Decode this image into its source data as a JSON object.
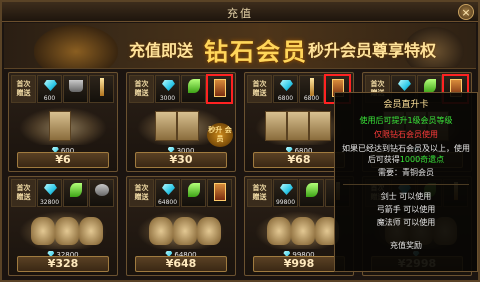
{
  "window": {
    "title": "充值",
    "close_glyph": "×"
  },
  "banner": {
    "part1": "充值即送",
    "part2": "钻石会员",
    "part3": "秒升会员尊享特权"
  },
  "first_gift_label": "首次\n赠送",
  "cards": [
    {
      "items": [
        {
          "icon": "diamond-icon",
          "count": "600"
        },
        {
          "icon": "cup-icon",
          "count": ""
        },
        {
          "icon": "staff-icon",
          "count": ""
        }
      ],
      "diamonds": "600",
      "price": "¥6",
      "highlight": null
    },
    {
      "items": [
        {
          "icon": "diamond-icon",
          "count": "3000"
        },
        {
          "icon": "leaf-icon",
          "count": ""
        },
        {
          "icon": "member-card-icon",
          "count": ""
        }
      ],
      "diamonds": "3000",
      "price": "¥30",
      "badge": "秒升\n会员",
      "highlight": 2
    },
    {
      "items": [
        {
          "icon": "diamond-icon",
          "count": "6800"
        },
        {
          "icon": "staff-icon",
          "count": "6800"
        },
        {
          "icon": "member-card-icon",
          "count": ""
        }
      ],
      "diamonds": "6800",
      "price": "¥68",
      "highlight": 2
    },
    {
      "items": [
        {
          "icon": "diamond-icon",
          "count": ""
        },
        {
          "icon": "leaf-icon",
          "count": ""
        },
        {
          "icon": "member-card-icon",
          "count": ""
        }
      ],
      "diamonds": "",
      "price": "¥",
      "highlight": 2
    },
    {
      "items": [
        {
          "icon": "diamond-icon",
          "count": "32800"
        },
        {
          "icon": "leaf-icon",
          "count": ""
        },
        {
          "icon": "ring-icon",
          "count": ""
        }
      ],
      "diamonds": "32800",
      "price": "¥328",
      "highlight": null
    },
    {
      "items": [
        {
          "icon": "diamond-icon",
          "count": "64800"
        },
        {
          "icon": "leaf-icon",
          "count": ""
        },
        {
          "icon": "member-card-icon",
          "count": ""
        }
      ],
      "diamonds": "64800",
      "price": "¥648",
      "highlight": null
    },
    {
      "items": [
        {
          "icon": "diamond-icon",
          "count": "99800"
        },
        {
          "icon": "leaf-icon",
          "count": ""
        },
        {
          "icon": "staff-icon",
          "count": ""
        }
      ],
      "diamonds": "99800",
      "price": "¥998",
      "highlight": null
    },
    {
      "items": [
        {
          "icon": "diamond-icon",
          "count": ""
        },
        {
          "icon": "leaf-icon",
          "count": ""
        },
        {
          "icon": "staff-icon",
          "count": ""
        }
      ],
      "diamonds": "",
      "price": "¥2998",
      "highlight": null
    }
  ],
  "tooltip": {
    "title": "会员直升卡",
    "line1": "使用后可提升1级会员等级",
    "line2": "仅限钻石会员使用",
    "line3a": "如果已经达到钻石会员及以上，使用后可获得",
    "line3b": "1000奇遗点",
    "line4": "需要：青铜会员",
    "jobs": [
      "剑士  可以使用",
      "弓箭手  可以使用",
      "魔法师  可以使用"
    ],
    "footer": "充值奖励"
  }
}
